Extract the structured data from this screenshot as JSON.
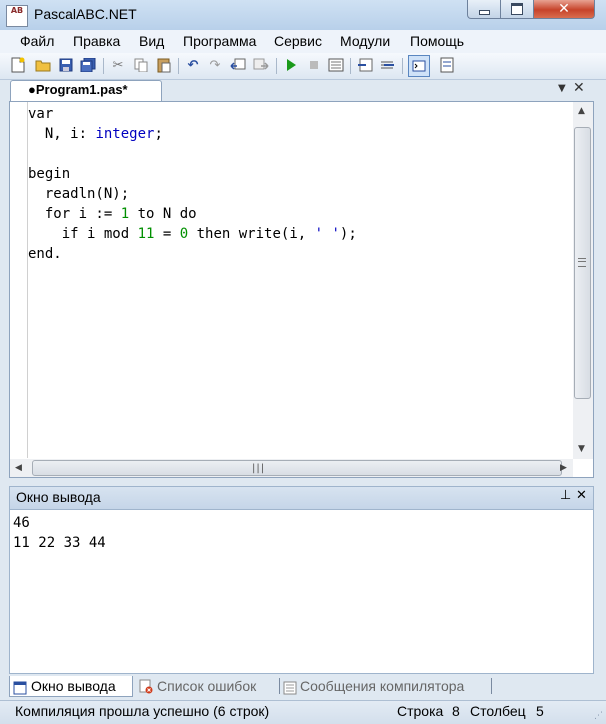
{
  "window": {
    "title": "PascalABC.NET",
    "app_icon_text": "AB"
  },
  "menu": [
    "Файл",
    "Правка",
    "Вид",
    "Программа",
    "Сервис",
    "Модули",
    "Помощь"
  ],
  "editor": {
    "tab_label": "●Program1.pas*",
    "lines": [
      "var",
      "  N, i: integer;",
      "",
      "begin",
      "  readln(N);",
      "  for i := 1 to N do",
      "    if i mod 11 = 0 then write(i, ' ');",
      "end."
    ]
  },
  "output": {
    "title": "Окно вывода",
    "lines": [
      "46",
      "11 22 33 44"
    ]
  },
  "bottom_tabs": [
    "Окно вывода",
    "Список ошибок",
    "Сообщения компилятора"
  ],
  "status": {
    "message": "Компиляция прошла успешно (6 строк)",
    "row_label": "Строка",
    "row_value": "8",
    "col_label": "Столбец",
    "col_value": "5"
  },
  "colors": {
    "keyword_type": "#0000c0",
    "number": "#009000",
    "close_button": "#c7432a"
  }
}
